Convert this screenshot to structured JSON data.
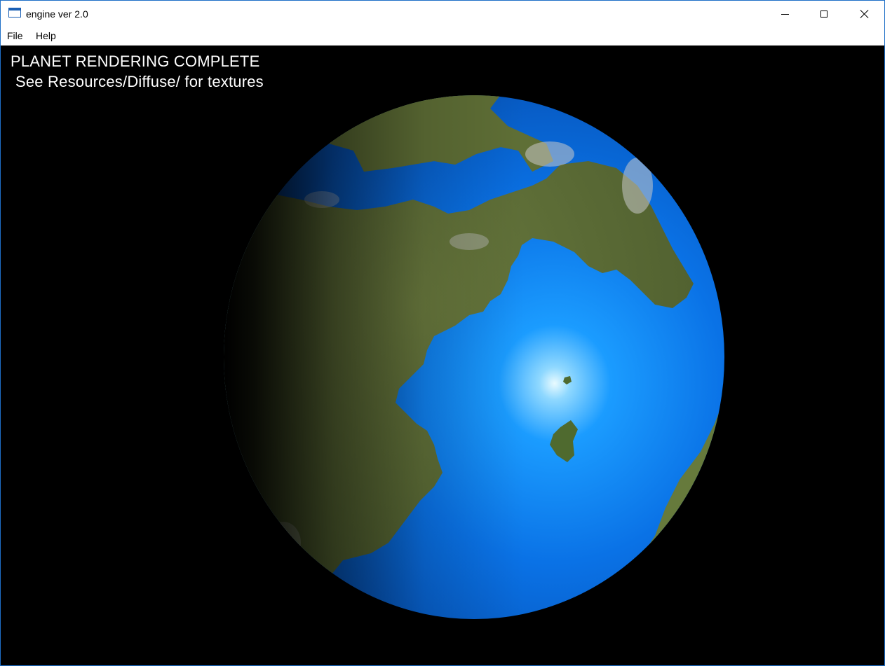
{
  "window": {
    "title": "engine ver 2.0"
  },
  "menu": {
    "items": [
      "File",
      "Help"
    ]
  },
  "viewport": {
    "status_line1": "PLANET RENDERING COMPLETE",
    "status_line2": "See Resources/Diffuse/ for textures"
  },
  "colors": {
    "ocean": "#0a6fe0",
    "ocean_highlight": "#d8f4ff",
    "land": "#5a6b35",
    "snow": "#cfcfcf",
    "background": "#000000"
  }
}
